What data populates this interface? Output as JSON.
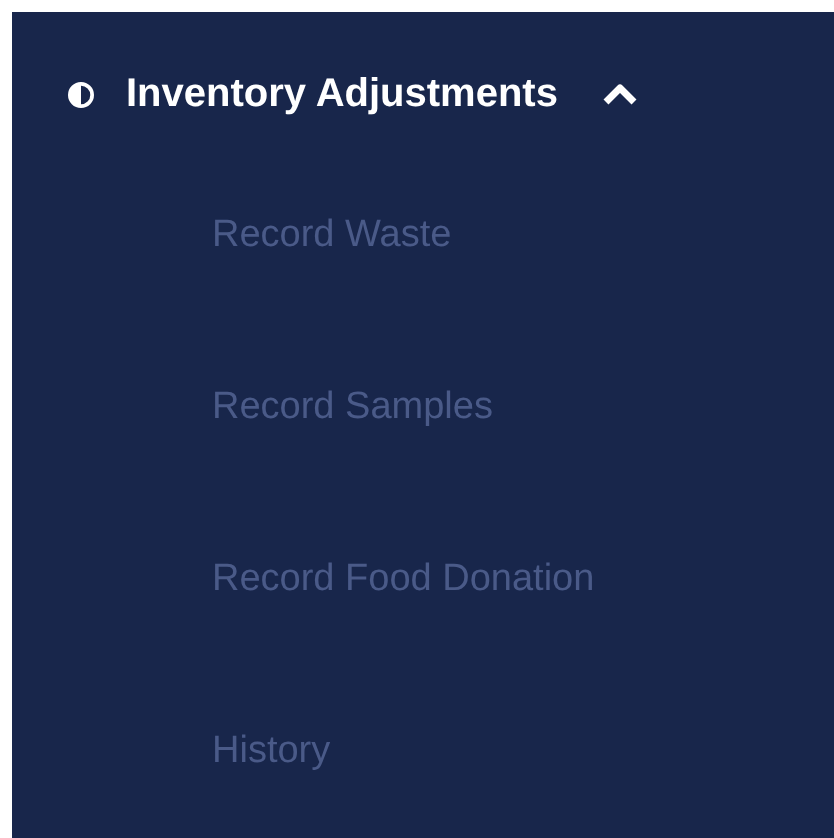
{
  "menu": {
    "label": "Inventory Adjustments",
    "expanded": true,
    "items": [
      {
        "label": "Record Waste"
      },
      {
        "label": "Record Samples"
      },
      {
        "label": "Record Food Donation"
      },
      {
        "label": "History"
      }
    ]
  }
}
